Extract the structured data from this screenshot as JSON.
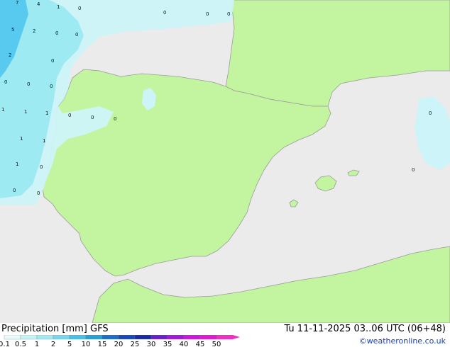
{
  "map": {
    "colors": {
      "sea": "#ebebeb",
      "land": "#c3f5a0",
      "coast": "#9a9a9a",
      "precip_light": "#cdf4f8",
      "precip_mid": "#9ae9f2",
      "precip_strong": "#55c8ee"
    },
    "values": [
      {
        "text": "7"
      },
      {
        "text": "4"
      },
      {
        "text": "1"
      },
      {
        "text": "0"
      },
      {
        "text": "0"
      },
      {
        "text": "0"
      },
      {
        "text": "0"
      },
      {
        "text": "5"
      },
      {
        "text": "2"
      },
      {
        "text": "0"
      },
      {
        "text": "0"
      },
      {
        "text": "2"
      },
      {
        "text": "0"
      },
      {
        "text": "0"
      },
      {
        "text": "0"
      },
      {
        "text": "0"
      },
      {
        "text": "1"
      },
      {
        "text": "1"
      },
      {
        "text": "1"
      },
      {
        "text": "0"
      },
      {
        "text": "0"
      },
      {
        "text": "0"
      },
      {
        "text": "0"
      },
      {
        "text": "1"
      },
      {
        "text": "1"
      },
      {
        "text": "1"
      },
      {
        "text": "0"
      },
      {
        "text": "0"
      },
      {
        "text": "0"
      },
      {
        "text": "0"
      }
    ]
  },
  "footer": {
    "title": "Precipitation [mm] GFS",
    "time": "Tu 11-11-2025 03..06 UTC (06+48)",
    "credit": "©weatheronline.co.uk"
  },
  "legend": {
    "ticks": [
      "0.1",
      "0.5",
      "1",
      "2",
      "5",
      "10",
      "15",
      "20",
      "25",
      "30",
      "35",
      "40",
      "45",
      "50"
    ],
    "colors": [
      "#e8fcfc",
      "#c7f3f7",
      "#a4e9f1",
      "#7bd8ec",
      "#4cc0e8",
      "#2a9fd8",
      "#1c6fc8",
      "#1a48b8",
      "#1a2aa0",
      "#6a20c8",
      "#a01ad8",
      "#c81ad8",
      "#e01ad0",
      "#f030c0"
    ]
  }
}
